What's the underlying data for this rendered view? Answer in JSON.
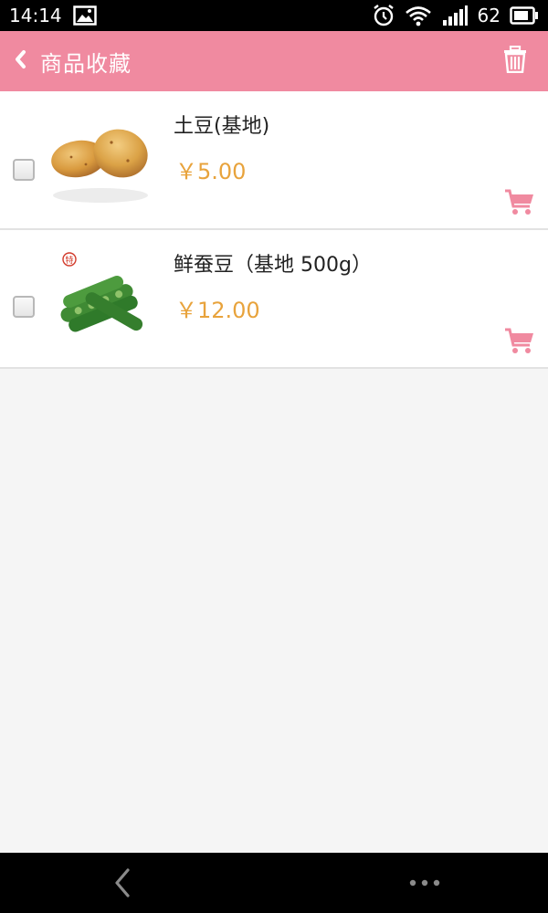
{
  "status_bar": {
    "time": "14:14",
    "battery": "62",
    "icons": [
      "image-icon",
      "alarm-icon",
      "wifi-icon",
      "signal-icon",
      "battery-icon"
    ]
  },
  "header": {
    "title": "商品收藏",
    "back_icon": "chevron-left-icon",
    "action_icon": "trash-icon",
    "background_color": "#f08aa0"
  },
  "items": [
    {
      "name": "土豆(基地)",
      "price": "￥5.00",
      "checked": false,
      "image": "potato-image",
      "cart_icon": "cart-icon"
    },
    {
      "name": "鲜蚕豆（基地 500g）",
      "price": "￥12.00",
      "checked": false,
      "image": "broad-beans-image",
      "badge": "特",
      "cart_icon": "cart-icon"
    }
  ],
  "colors": {
    "accent": "#f08aa0",
    "price": "#e8a33c"
  },
  "nav_bar": {
    "back_icon": "nav-back-icon",
    "more_icon": "more-dots-icon"
  }
}
